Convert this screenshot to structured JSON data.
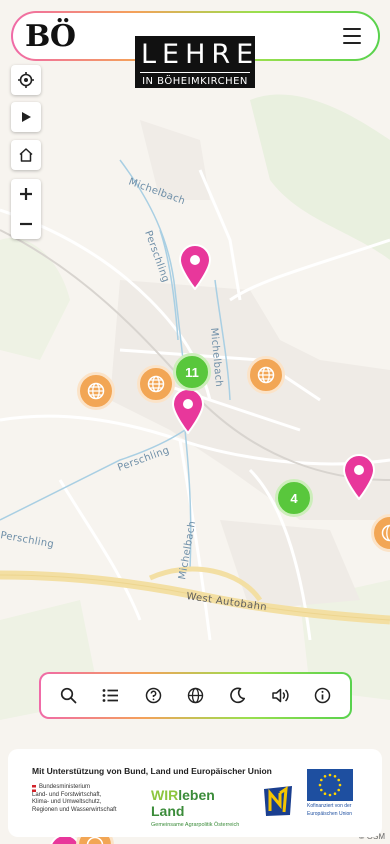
{
  "header": {
    "logo_text": "BÖ",
    "brand_title": "LEHRE",
    "brand_subtitle": "IN BÖHEIMKIRCHEN"
  },
  "map": {
    "labels": {
      "michelbach_north": "Michelbach",
      "perschling_north": "Perschling",
      "michelbach_center": "Michelbach",
      "perschling_center": "Perschling",
      "perschling_west": "Perschling",
      "michelbach_south": "Michelbach",
      "motorway": "West Autobahn"
    },
    "attribution": "© OSM",
    "clusters": [
      {
        "count": "11"
      },
      {
        "count": "4"
      }
    ]
  },
  "toolbar": {
    "icons": [
      "search-icon",
      "list-icon",
      "help-icon",
      "globe-icon",
      "moon-icon",
      "volume-icon",
      "info-icon"
    ]
  },
  "footer": {
    "title": "Mit Unterstützung von Bund, Land und Europäischer Union",
    "ministry_lines": [
      "Bundesministerium",
      "Land- und Forstwirtschaft,",
      "Klima- und Umweltschutz,",
      "Regionen und Wasserwirtschaft"
    ],
    "wir_leben_prefix": "WIR",
    "wir_leben_rest": "leben Land",
    "wir_leben_sub": "Gemeinsame Agrarpolitik Österreich",
    "eu_caption_1": "Kofinanziert von der",
    "eu_caption_2": "Europäischen Union"
  },
  "colors": {
    "accent_pink": "#e8379b",
    "accent_orange": "#f2a655",
    "accent_green": "#59c73c"
  }
}
